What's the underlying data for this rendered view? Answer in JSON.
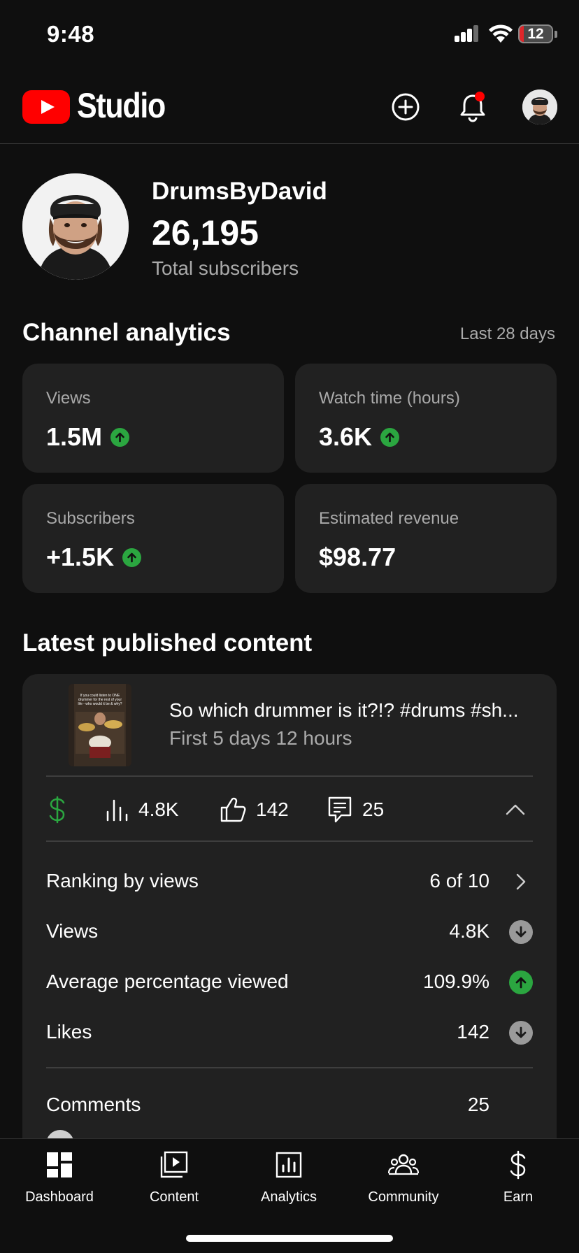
{
  "status_bar": {
    "time": "9:48",
    "battery": "12",
    "battery_level": 0.12
  },
  "header": {
    "brand": "Studio",
    "icons": [
      "youtube-logo",
      "create-icon",
      "notifications-icon",
      "account-avatar"
    ]
  },
  "channel": {
    "name": "DrumsByDavid",
    "subscribers": "26,195",
    "subscribers_label": "Total subscribers"
  },
  "analytics": {
    "title": "Channel analytics",
    "range": "Last 28 days",
    "cards": [
      {
        "label": "Views",
        "value": "1.5M",
        "trend": "up"
      },
      {
        "label": "Watch time (hours)",
        "value": "3.6K",
        "trend": "up"
      },
      {
        "label": "Subscribers",
        "value": "+1.5K",
        "trend": "up"
      },
      {
        "label": "Estimated revenue",
        "value": "$98.77",
        "trend": "none"
      }
    ]
  },
  "latest": {
    "title": "Latest published content",
    "video": {
      "title": "So which drummer is it?!? #drums #sh...",
      "age": "First 5 days 12 hours",
      "thumb_caption": "If you could listen to ONE drummer for the rest of your life - who would it be & why?"
    },
    "quick_stats": {
      "views": "4.8K",
      "likes": "142",
      "comments": "25"
    },
    "metrics": [
      {
        "label": "Ranking by views",
        "value": "6 of 10",
        "end": "chevron"
      },
      {
        "label": "Views",
        "value": "4.8K",
        "end": "down"
      },
      {
        "label": "Average percentage viewed",
        "value": "109.9%",
        "end": "up"
      },
      {
        "label": "Likes",
        "value": "142",
        "end": "down"
      }
    ],
    "comments": {
      "label": "Comments",
      "value": "25"
    }
  },
  "nav": {
    "items": [
      {
        "label": "Dashboard",
        "icon": "dashboard-icon"
      },
      {
        "label": "Content",
        "icon": "content-icon"
      },
      {
        "label": "Analytics",
        "icon": "analytics-icon"
      },
      {
        "label": "Community",
        "icon": "community-icon"
      },
      {
        "label": "Earn",
        "icon": "earn-icon"
      }
    ]
  },
  "colors": {
    "background": "#0f0f0f",
    "card": "#212121",
    "brand_red": "#ff0000",
    "trend_up": "#2ba640",
    "trend_down": "#9a9a9a",
    "muted_text": "#aaaaaa"
  }
}
